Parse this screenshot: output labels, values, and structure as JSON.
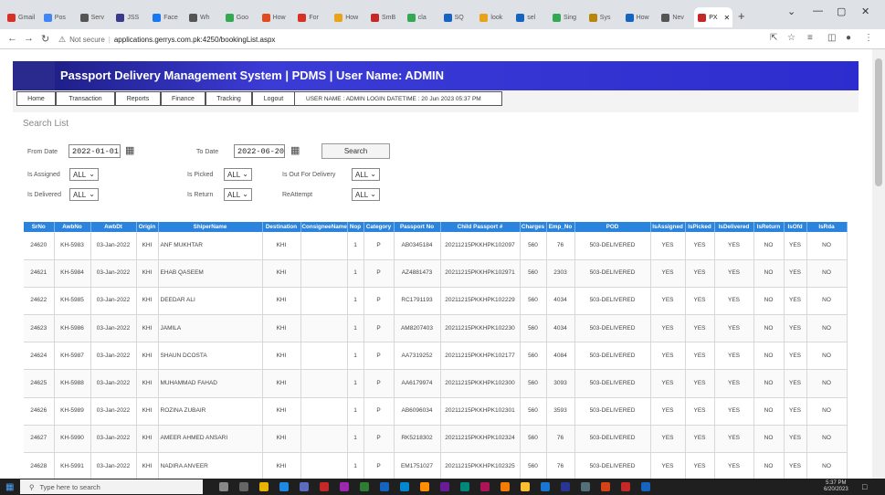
{
  "browser": {
    "tabs": [
      {
        "label": "Gmail",
        "color": "#d93025"
      },
      {
        "label": "Pos",
        "color": "#4285f4"
      },
      {
        "label": "Serv",
        "color": "#555555"
      },
      {
        "label": "JSS",
        "color": "#3a3a8c"
      },
      {
        "label": "Face",
        "color": "#1877f2"
      },
      {
        "label": "Wh",
        "color": "#555555"
      },
      {
        "label": "Goo",
        "color": "#34a853"
      },
      {
        "label": "How",
        "color": "#e04b20"
      },
      {
        "label": "For",
        "color": "#d93025"
      },
      {
        "label": "How",
        "color": "#e8a317"
      },
      {
        "label": "SmB",
        "color": "#c62828"
      },
      {
        "label": "cla",
        "color": "#34a853"
      },
      {
        "label": "SQ",
        "color": "#1565c0"
      },
      {
        "label": "look",
        "color": "#e8a317"
      },
      {
        "label": "sel",
        "color": "#1565c0"
      },
      {
        "label": "Sing",
        "color": "#34a853"
      },
      {
        "label": "Sys",
        "color": "#b8860b"
      },
      {
        "label": "How",
        "color": "#1565c0"
      },
      {
        "label": "Nev",
        "color": "#555555"
      },
      {
        "label": "PX",
        "color": "#c62828"
      }
    ],
    "address": {
      "security": "Not secure",
      "url": "applications.gerrys.com.pk:4250/bookingList.aspx"
    }
  },
  "app": {
    "title": "Passport Delivery Management System | PDMS | User Name: ADMIN",
    "menu": [
      "Home",
      "Transaction",
      "Reports",
      "Finance",
      "Tracking",
      "Logout"
    ],
    "user_info": "USER NAME : ADMIN LOGIN DATETIME : 20 Jun 2023 05:37 PM"
  },
  "search": {
    "title": "Search List",
    "from_label": "From Date",
    "from_value": "2022-01-01",
    "to_label": "To Date",
    "to_value": "2022-06-20",
    "button": "Search",
    "filters": [
      {
        "label": "Is Assigned",
        "value": "ALL"
      },
      {
        "label": "Is Picked",
        "value": "ALL"
      },
      {
        "label": "Is Out For Delivery",
        "value": "ALL"
      },
      {
        "label": "Is Delivered",
        "value": "ALL"
      },
      {
        "label": "Is Return",
        "value": "ALL"
      },
      {
        "label": "ReAttempt",
        "value": "ALL"
      }
    ]
  },
  "table": {
    "columns": [
      "SrNo",
      "AwbNo",
      "AwbDt",
      "Origin",
      "ShiperName",
      "Destination",
      "ConsigneeName",
      "Nop",
      "Category",
      "Passport No",
      "Child Passport #",
      "Charges",
      "Emp_No",
      "POD",
      "IsAssigned",
      "IsPicked",
      "IsDelivered",
      "IsReturn",
      "IsOfd",
      "IsRda"
    ],
    "rows": [
      [
        "24620",
        "KH-5983",
        "03-Jan-2022",
        "KHI",
        "ANF MUKHTAR",
        "KHI",
        "",
        "1",
        "P",
        "AB0345184",
        "20211215PKKHPK102097",
        "560",
        "76",
        "503-DELIVERED",
        "YES",
        "YES",
        "YES",
        "NO",
        "YES",
        "NO"
      ],
      [
        "24621",
        "KH-5984",
        "03-Jan-2022",
        "KHI",
        "EHAB QASEEM",
        "KHI",
        "",
        "1",
        "P",
        "AZ4881473",
        "20211215PKKHPK102971",
        "560",
        "2303",
        "503-DELIVERED",
        "YES",
        "YES",
        "YES",
        "NO",
        "YES",
        "NO"
      ],
      [
        "24622",
        "KH-5985",
        "03-Jan-2022",
        "KHI",
        "DEEDAR ALI",
        "KHI",
        "",
        "1",
        "P",
        "RC1791193",
        "20211215PKKHPK102229",
        "560",
        "4034",
        "503-DELIVERED",
        "YES",
        "YES",
        "YES",
        "NO",
        "YES",
        "NO"
      ],
      [
        "24623",
        "KH-5986",
        "03-Jan-2022",
        "KHI",
        "JAMILA",
        "KHI",
        "",
        "1",
        "P",
        "AM8207403",
        "20211215PKKHPK102230",
        "560",
        "4034",
        "503-DELIVERED",
        "YES",
        "YES",
        "YES",
        "NO",
        "YES",
        "NO"
      ],
      [
        "24624",
        "KH-5987",
        "03-Jan-2022",
        "KHI",
        "SHAUN DCOSTA",
        "KHI",
        "",
        "1",
        "P",
        "AA7319252",
        "20211215PKKHPK102177",
        "560",
        "4084",
        "503-DELIVERED",
        "YES",
        "YES",
        "YES",
        "NO",
        "YES",
        "NO"
      ],
      [
        "24625",
        "KH-5988",
        "03-Jan-2022",
        "KHI",
        "MUHAMMAD FAHAD",
        "KHI",
        "",
        "1",
        "P",
        "AA6179974",
        "20211215PKKHPK102300",
        "560",
        "3093",
        "503-DELIVERED",
        "YES",
        "YES",
        "YES",
        "NO",
        "YES",
        "NO"
      ],
      [
        "24626",
        "KH-5989",
        "03-Jan-2022",
        "KHI",
        "ROZINA ZUBAIR",
        "KHI",
        "",
        "1",
        "P",
        "AB6096034",
        "20211215PKKHPK102301",
        "560",
        "3593",
        "503-DELIVERED",
        "YES",
        "YES",
        "YES",
        "NO",
        "YES",
        "NO"
      ],
      [
        "24627",
        "KH-5990",
        "03-Jan-2022",
        "KHI",
        "AMEER AHMED ANSARI",
        "KHI",
        "",
        "1",
        "P",
        "RK5218302",
        "20211215PKKHPK102324",
        "560",
        "76",
        "503-DELIVERED",
        "YES",
        "YES",
        "YES",
        "NO",
        "YES",
        "NO"
      ],
      [
        "24628",
        "KH-5991",
        "03-Jan-2022",
        "KHI",
        "NADIRA ANVEER",
        "KHI",
        "",
        "1",
        "P",
        "EM1751027",
        "20211215PKKHPK102325",
        "560",
        "76",
        "503-DELIVERED",
        "YES",
        "YES",
        "YES",
        "NO",
        "YES",
        "NO"
      ]
    ]
  },
  "taskbar": {
    "search_placeholder": "Type here to search",
    "time": "5:37 PM",
    "date": "6/20/2023"
  }
}
